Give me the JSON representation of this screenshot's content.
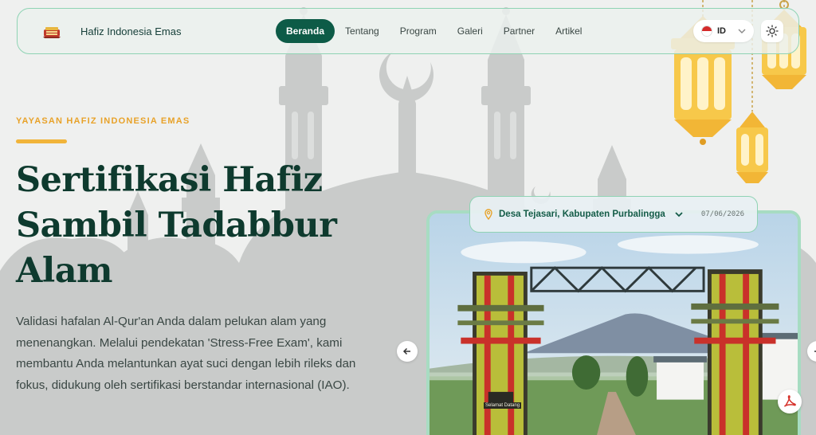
{
  "navbar": {
    "brand_name": "Hafiz Indonesia Emas",
    "items": [
      {
        "label": "Beranda",
        "active": true
      },
      {
        "label": "Tentang",
        "active": false
      },
      {
        "label": "Program",
        "active": false
      },
      {
        "label": "Galeri",
        "active": false
      },
      {
        "label": "Partner",
        "active": false
      },
      {
        "label": "Artikel",
        "active": false
      }
    ],
    "language": "ID",
    "theme_icon": "sun-icon"
  },
  "hero": {
    "eyebrow": "YAYASAN HAFIZ INDONESIA EMAS",
    "headline_line1": "Sertifikasi Hafiz",
    "headline_line2": "Sambil Tadabbur",
    "headline_line3": "Alam",
    "description": "Validasi hafalan Al-Qur'an Anda dalam pelukan alam yang menenangkan. Melalui pendekatan 'Stress-Free Exam', kami membantu Anda melantunkan ayat suci dengan lebih rileks dan fokus, didukung oleh sertifikasi berstandar internasional (IAO)."
  },
  "gallery": {
    "location": "Desa Tejasari, Kabupaten Purbalingga",
    "date": "07/06/2026",
    "gate_sign": "Selamat Datang",
    "prev_icon": "arrow-left-icon",
    "next_icon": "arrow-right-icon",
    "pdf_icon": "pdf-icon"
  },
  "colors": {
    "primary": "#0d5b47",
    "accent": "#f1b43a",
    "headline": "#0e3a2e"
  }
}
